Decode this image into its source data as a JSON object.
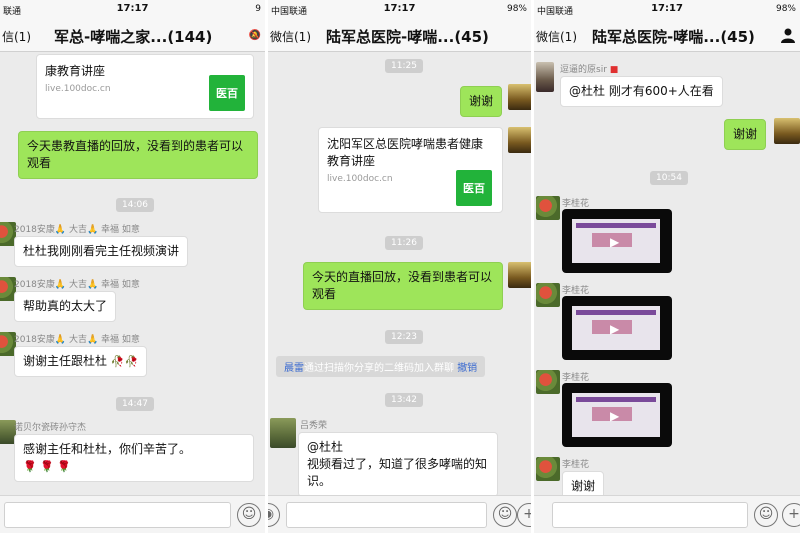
{
  "panels": [
    {
      "status": {
        "carrier": "联通",
        "time": "17:17",
        "battery": "9"
      },
      "nav": {
        "title": "军总-哮喘之家...(144)"
      },
      "card_top": {
        "title": "康教育讲座",
        "source": "live.100doc.cn",
        "logo": "医百"
      },
      "msg_green": "今天患教直播的回放，没看到的患者可以观看",
      "ts1": "14:06",
      "sender1": "2018安康🙏 大吉🙏 幸福  如意",
      "msg1": "杜杜我刚刚看完主任视频演讲",
      "sender2": "2018安康🙏 大吉🙏 幸福  如意",
      "msg2": "帮助真的太大了",
      "sender3": "2018安康🙏 大吉🙏 幸福  如意",
      "msg3": "谢谢主任跟杜杜",
      "ts2": "14:47",
      "sender4": "诺贝尔瓷砖孙守杰",
      "msg4": "感谢主任和杜杜，你们辛苦了。"
    },
    {
      "status": {
        "carrier": "中国联通",
        "time": "17:17",
        "battery": "98%"
      },
      "nav": {
        "back": "微信(1)",
        "title": "陆军总医院-哮喘...(45)"
      },
      "ts1": "11:25",
      "msg_thanks": "谢谢",
      "card": {
        "title": "沈阳军区总医院哮喘患者健康教育讲座",
        "source": "live.100doc.cn",
        "logo": "医百"
      },
      "ts2": "11:26",
      "msg_green": "今天的直播回放，没看到患者可以观看",
      "ts3": "12:23",
      "sys": {
        "name": "晨雷",
        "text": "通过扫描你分享的二维码加入群聊",
        "action": "撤销"
      },
      "ts4": "13:42",
      "sender": "吕秀荣",
      "msg": "@杜杜\n视频看过了，知道了很多哮喘的知识。"
    },
    {
      "status": {
        "carrier": "中国联通",
        "time": "17:17",
        "battery": "98%"
      },
      "nav": {
        "back": "微信(1)",
        "title": "陆军总医院-哮喘...(45)"
      },
      "sender1": "逗逼的原sir",
      "msg1": "@杜杜 刚才有600+人在看",
      "msg_thanks": "谢谢",
      "ts1": "10:54",
      "sender2": "李桂花",
      "sender3": "李桂花",
      "sender4": "李桂花",
      "sender5": "李桂花",
      "msg_last": "谢谢"
    }
  ]
}
